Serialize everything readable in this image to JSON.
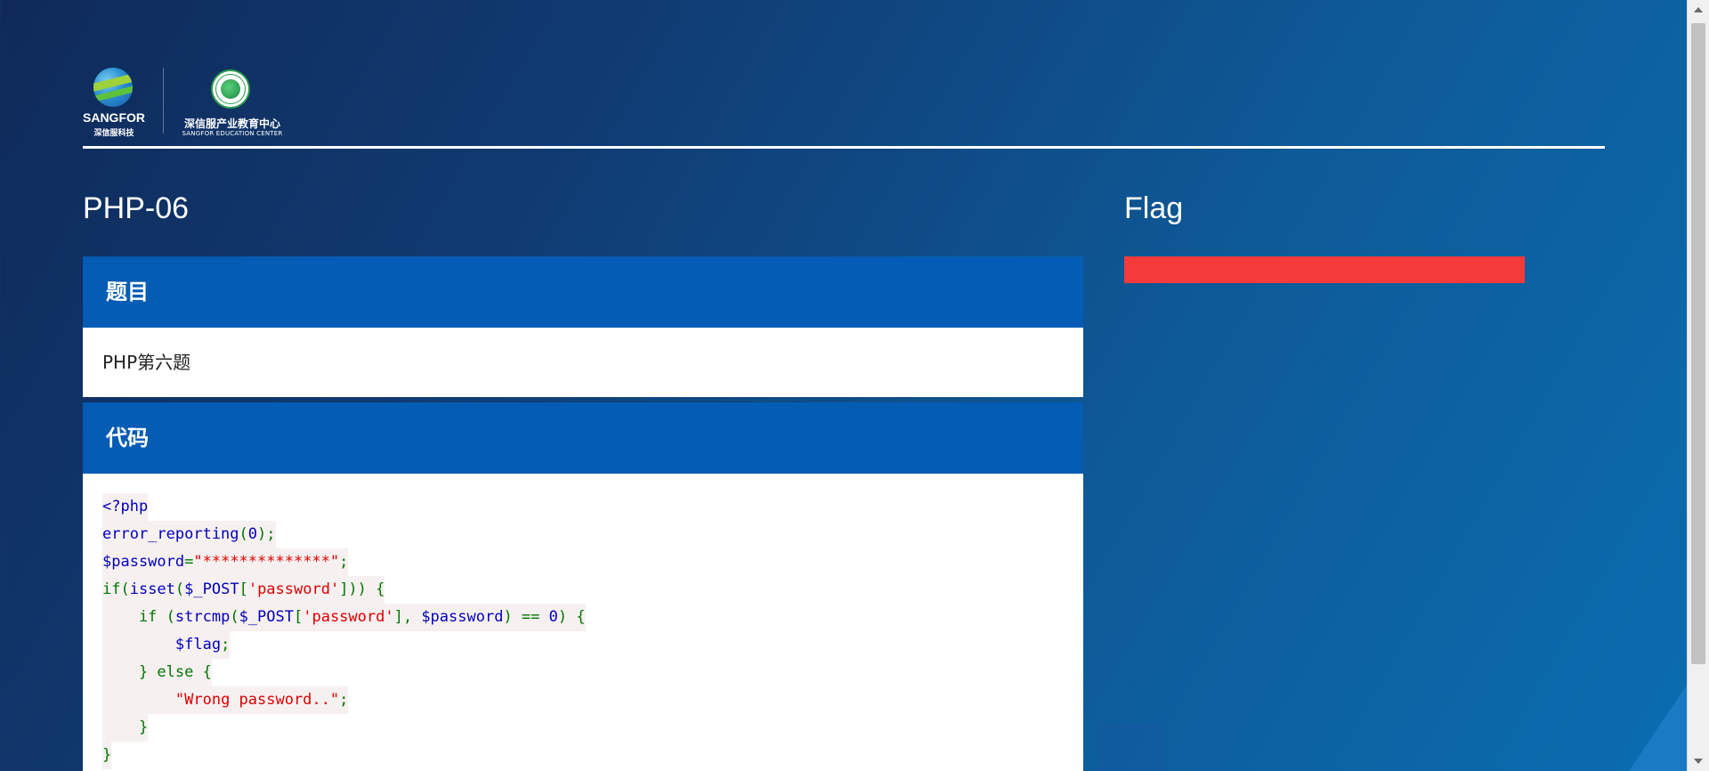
{
  "header": {
    "brand": {
      "name": "SANGFOR",
      "sub": "深信服科技"
    },
    "edu": {
      "name": "深信服产业教育中心",
      "sub": "SANGFOR EDUCATION CENTER"
    }
  },
  "challenge": {
    "title": "PHP-06",
    "question_heading": "题目",
    "question_text": "PHP第六题",
    "code_heading": "代码",
    "code_lines": [
      [
        {
          "t": "<?php",
          "c": "d"
        }
      ],
      [
        {
          "t": "error_reporting",
          "c": "d"
        },
        {
          "t": "(",
          "c": "k"
        },
        {
          "t": "0",
          "c": "d"
        },
        {
          "t": ");",
          "c": "k"
        }
      ],
      [
        {
          "t": "$password",
          "c": "d"
        },
        {
          "t": "=",
          "c": "k"
        },
        {
          "t": "\"**************\"",
          "c": "s"
        },
        {
          "t": ";",
          "c": "k"
        }
      ],
      [
        {
          "t": "if(",
          "c": "k"
        },
        {
          "t": "isset",
          "c": "d"
        },
        {
          "t": "(",
          "c": "k"
        },
        {
          "t": "$_POST",
          "c": "d"
        },
        {
          "t": "[",
          "c": "k"
        },
        {
          "t": "'password'",
          "c": "s"
        },
        {
          "t": "])) {",
          "c": "k"
        }
      ],
      [
        {
          "t": "    if (",
          "c": "k"
        },
        {
          "t": "strcmp",
          "c": "d"
        },
        {
          "t": "(",
          "c": "k"
        },
        {
          "t": "$_POST",
          "c": "d"
        },
        {
          "t": "[",
          "c": "k"
        },
        {
          "t": "'password'",
          "c": "s"
        },
        {
          "t": "], ",
          "c": "k"
        },
        {
          "t": "$password",
          "c": "d"
        },
        {
          "t": ") == ",
          "c": "k"
        },
        {
          "t": "0",
          "c": "d"
        },
        {
          "t": ") {",
          "c": "k"
        }
      ],
      [
        {
          "t": "        ",
          "c": "k"
        },
        {
          "t": "$flag",
          "c": "d"
        },
        {
          "t": ";",
          "c": "k"
        }
      ],
      [
        {
          "t": "    } else {",
          "c": "k"
        }
      ],
      [
        {
          "t": "        ",
          "c": "k"
        },
        {
          "t": "\"Wrong password..\"",
          "c": "s"
        },
        {
          "t": ";",
          "c": "k"
        }
      ],
      [
        {
          "t": "    }",
          "c": "k"
        }
      ],
      [
        {
          "t": "}",
          "c": "k"
        }
      ]
    ]
  },
  "flag": {
    "title": "Flag",
    "bar_color": "#f43a3a"
  },
  "colors": {
    "panel_heading": "#055cb4",
    "code_keyword": "#007700",
    "code_default": "#0000bb",
    "code_string": "#dd0000"
  },
  "icons": {
    "brand_logo": "sangfor-globe-icon",
    "edu_logo": "education-center-badge-icon"
  }
}
